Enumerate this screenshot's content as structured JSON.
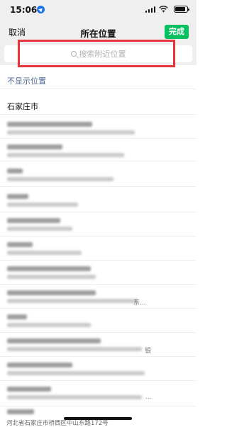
{
  "status_bar": {
    "time": "15:06",
    "icons": [
      "location-arrow-icon",
      "signal-icon",
      "wifi-icon",
      "battery-icon"
    ]
  },
  "nav": {
    "cancel_label": "取消",
    "title": "所在位置",
    "done_label": "完成"
  },
  "search": {
    "placeholder": "搜索附近位置",
    "icon": "search-icon"
  },
  "colors": {
    "accent_green": "#07c160",
    "highlight_red": "#e8343a",
    "link_blue": "#4d6a95"
  },
  "options": {
    "hide_location": "不显示位置",
    "city": "石家庄市"
  },
  "trailing_texts": [
    "东...",
    "银",
    "..."
  ],
  "bottom_address": "河北省石家庄市桥西区中山东路172号"
}
